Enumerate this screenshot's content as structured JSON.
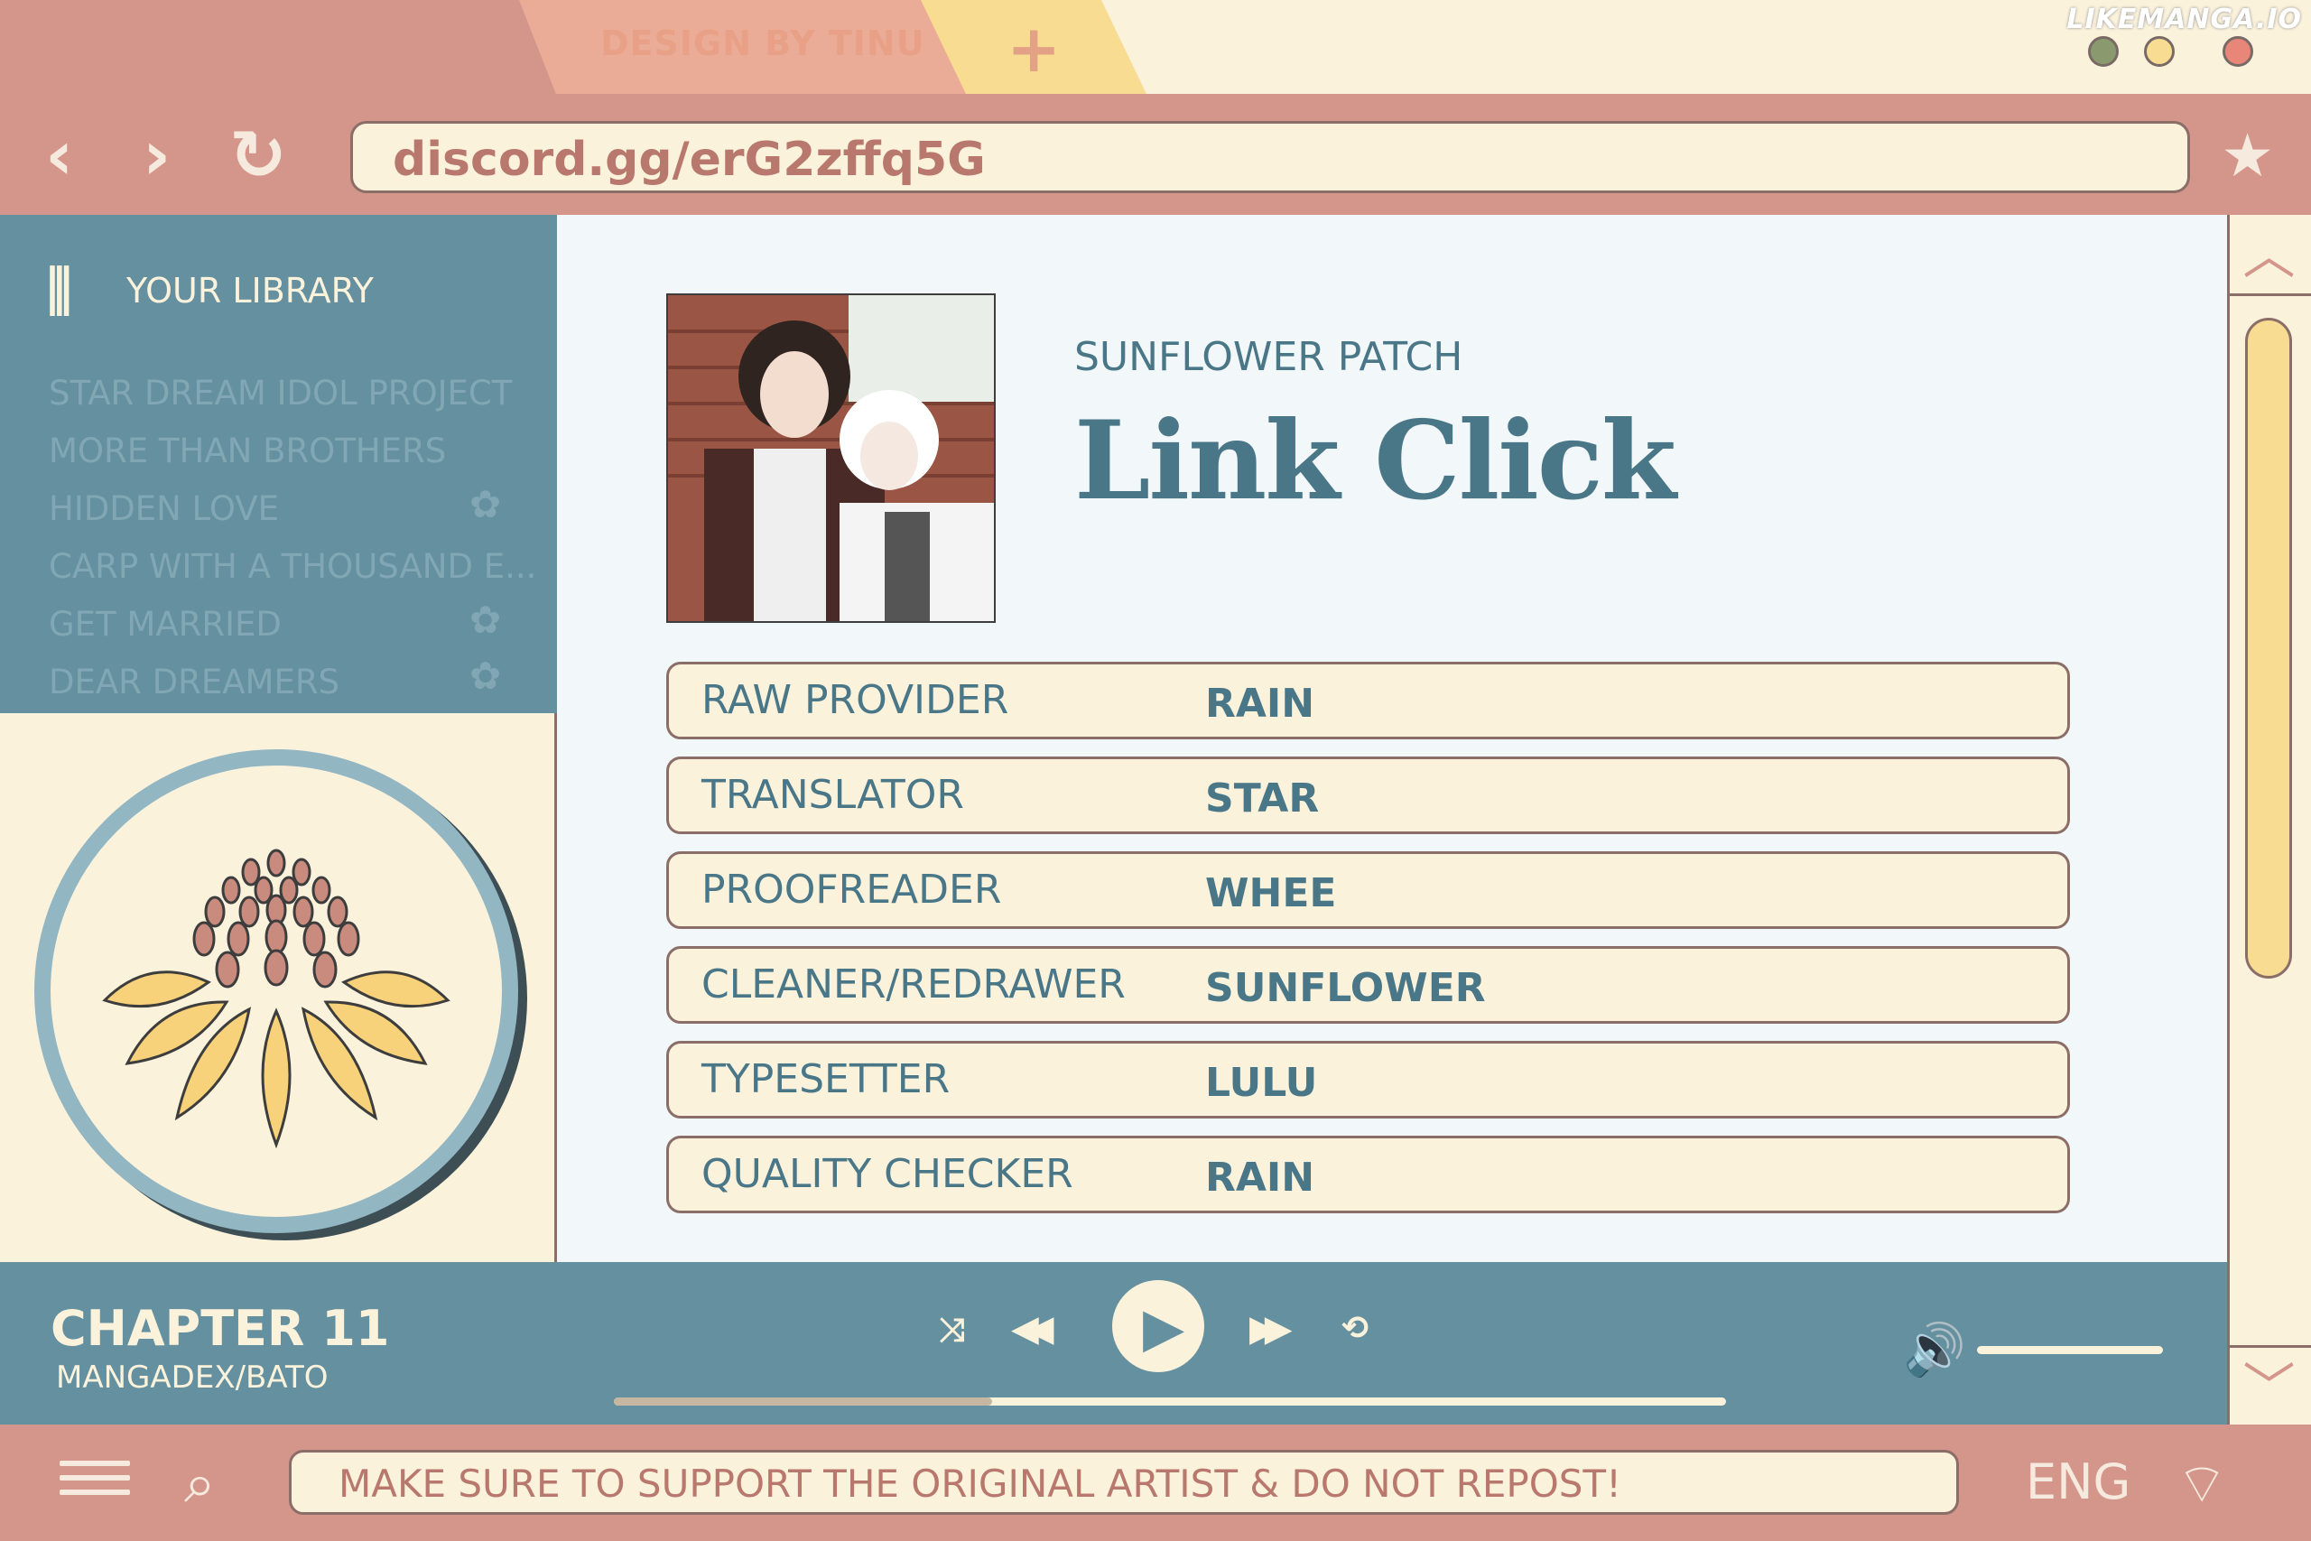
{
  "tabs": {
    "design_label": "DESIGN BY TINU",
    "add_label": "+"
  },
  "watermark": "LIKEMANGA.IO",
  "window_dots": [
    "#8a9a6e",
    "#f7dc92",
    "#e8867a"
  ],
  "nav": {
    "back": "‹",
    "forward": "›",
    "refresh": "↻",
    "bookmark": "★"
  },
  "url": "discord.gg/erG2zffq5G",
  "library": {
    "icon": "⫼",
    "title": "YOUR LIBRARY",
    "items": [
      {
        "label": "STAR DREAM IDOL PROJECT",
        "flower": ""
      },
      {
        "label": "MORE THAN BROTHERS",
        "flower": ""
      },
      {
        "label": "HIDDEN LOVE",
        "flower": "✿"
      },
      {
        "label": "CARP WITH A THOUSAND E...",
        "flower": ""
      },
      {
        "label": "GET MARRIED",
        "flower": "✿"
      },
      {
        "label": "DEAR DREAMERS",
        "flower": "✿"
      }
    ]
  },
  "series": {
    "group": "SUNFLOWER PATCH",
    "title": "Link Click"
  },
  "credits": [
    {
      "role": "RAW PROVIDER",
      "name": "RAIN"
    },
    {
      "role": "TRANSLATOR",
      "name": "STAR"
    },
    {
      "role": "PROOFREADER",
      "name": "WHEE"
    },
    {
      "role": "CLEANER/REDRAWER",
      "name": "SUNFLOWER"
    },
    {
      "role": "TYPESETTER",
      "name": "LULU"
    },
    {
      "role": "QUALITY CHECKER",
      "name": "RAIN"
    }
  ],
  "scroll": {
    "up": "︿",
    "down": "﹀"
  },
  "player": {
    "chapter": "CHAPTER 11",
    "source": "MANGADEX/BATO",
    "shuffle": "⤨",
    "prev": "◀◀",
    "play": "▶",
    "next": "▶▶",
    "repeat": "⟲",
    "volume_icon": "🔊",
    "progress": 0.34,
    "volume": 1.0
  },
  "bottom": {
    "search": "⌕",
    "notice": "MAKE SURE TO SUPPORT THE ORIGINAL ARTIST & DO NOT REPOST!",
    "lang": "ENG",
    "wifi": "⌔"
  }
}
